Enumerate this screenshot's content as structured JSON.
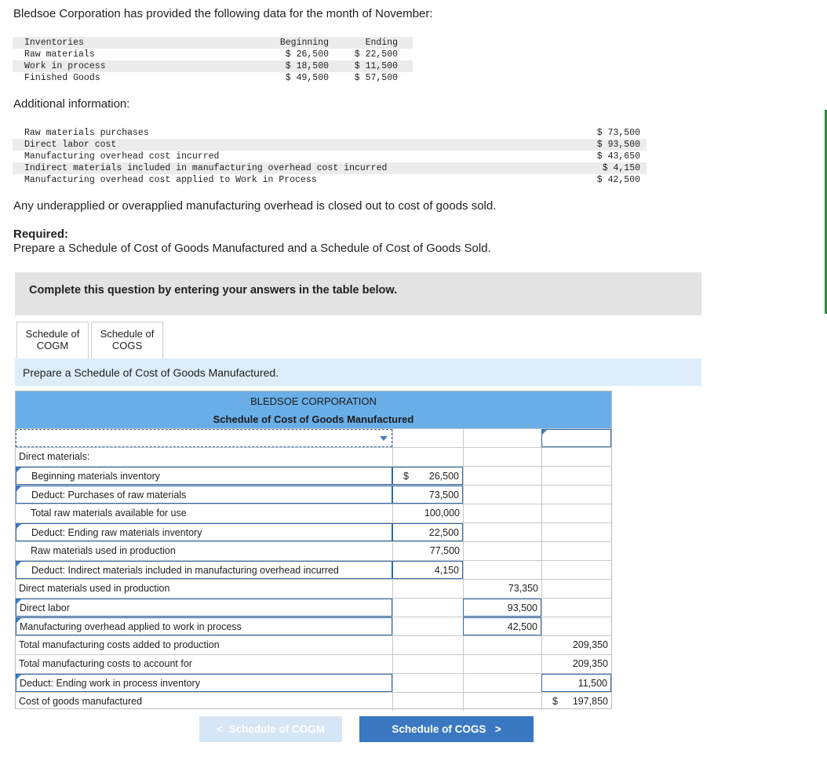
{
  "intro": "Bledsoe Corporation has provided the following data for the month of November:",
  "inventory": {
    "headers": [
      "Inventories",
      "Beginning",
      "Ending"
    ],
    "rows": [
      [
        "Raw materials",
        "$ 26,500",
        "$ 22,500"
      ],
      [
        "Work in process",
        "$ 18,500",
        "$ 11,500"
      ],
      [
        "Finished Goods",
        "$ 49,500",
        "$ 57,500"
      ]
    ]
  },
  "additional_label": "Additional information:",
  "additional": [
    [
      "Raw materials purchases",
      "$ 73,500"
    ],
    [
      "Direct labor cost",
      "$ 93,500"
    ],
    [
      "Manufacturing overhead cost incurred",
      "$ 43,650"
    ],
    [
      "Indirect materials included in manufacturing overhead cost incurred",
      "$ 4,150"
    ],
    [
      "Manufacturing overhead cost applied to Work in Process",
      "$ 42,500"
    ]
  ],
  "note": "Any underapplied or overapplied manufacturing overhead is closed out to cost of goods sold.",
  "required_heading": "Required:",
  "required_text": "Prepare a Schedule of Cost of Goods Manufactured and a Schedule of Cost of Goods Sold.",
  "instruction": "Complete this question by entering your answers in the table below.",
  "tabs": [
    {
      "line1": "Schedule of",
      "line2": "COGM"
    },
    {
      "line1": "Schedule of",
      "line2": "COGS"
    }
  ],
  "prepare_text": "Prepare a Schedule of Cost of Goods Manufactured.",
  "schedule": {
    "company": "BLEDSOE CORPORATION",
    "title": "Schedule of Cost of Goods Manufactured",
    "rows": [
      {
        "label": "Direct materials:",
        "a": "",
        "b": "",
        "c": ""
      },
      {
        "label": "Beginning materials inventory",
        "a": "26,500",
        "b": "",
        "c": "",
        "dollar_a": "$"
      },
      {
        "label": "Deduct: Purchases of raw materials",
        "a": "73,500",
        "b": "",
        "c": ""
      },
      {
        "label": "Total raw materials available for use",
        "a": "100,000",
        "b": "",
        "c": ""
      },
      {
        "label": "Deduct: Ending raw materials inventory",
        "a": "22,500",
        "b": "",
        "c": ""
      },
      {
        "label": "Raw materials used in production",
        "a": "77,500",
        "b": "",
        "c": ""
      },
      {
        "label": "Deduct: Indirect materials included in manufacturing overhead incurred",
        "a": "4,150",
        "b": "",
        "c": ""
      },
      {
        "label": "Direct materials used in production",
        "a": "",
        "b": "73,350",
        "c": ""
      },
      {
        "label": "Direct labor",
        "a": "",
        "b": "93,500",
        "c": ""
      },
      {
        "label": "Manufacturing overhead applied to work in process",
        "a": "",
        "b": "42,500",
        "c": ""
      },
      {
        "label": "Total manufacturing costs added to production",
        "a": "",
        "b": "",
        "c": "209,350"
      },
      {
        "label": "Total manufacturing costs to account for",
        "a": "",
        "b": "",
        "c": "209,350"
      },
      {
        "label": "Deduct: Ending work in process inventory",
        "a": "",
        "b": "",
        "c": "11,500"
      },
      {
        "label": "Cost of goods manufactured",
        "a": "",
        "b": "",
        "c": "197,850",
        "dollar_c": "$"
      }
    ]
  },
  "buttons": {
    "prev": "Schedule of COGM",
    "next": "Schedule of COGS"
  }
}
